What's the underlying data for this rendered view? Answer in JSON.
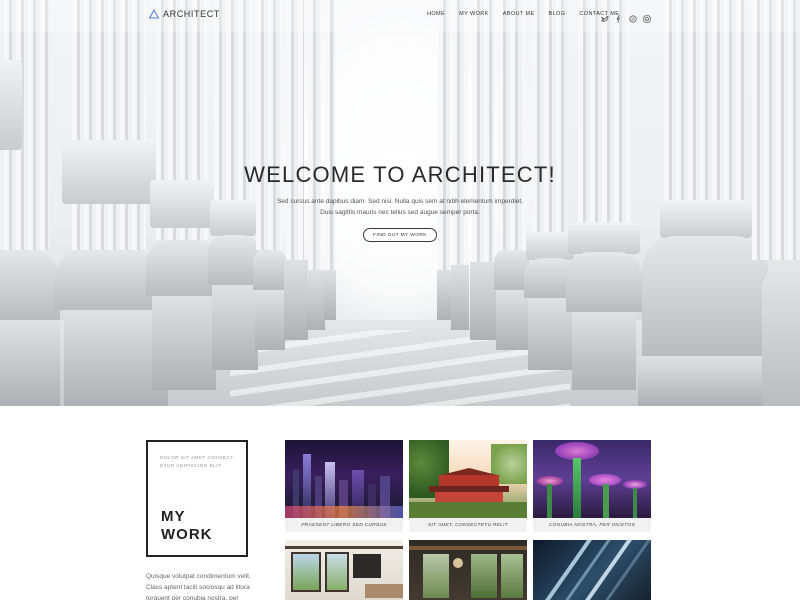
{
  "nav": {
    "logo_text": "ARCHITECT",
    "menu": [
      "HOME",
      "MY WORK",
      "ABOUT ME",
      "BLOG",
      "CONTACT ME"
    ],
    "social_icons": [
      "twitter-icon",
      "facebook-icon",
      "dribbble-icon",
      "instagram-icon"
    ]
  },
  "hero": {
    "title": "WELCOME TO ARCHITECT!",
    "subtitle_line1": "Sed cursus ante dapibus diam. Sed nisi. Nulla quis sem at nibh elementum imperdiet.",
    "subtitle_line2": "Duis sagittis mauris nec tellus sed augue semper porta.",
    "button_label": "FIND OUT MY WORK"
  },
  "work": {
    "kicker": "DOLOR SIT AMET CONSECT ETUR ADIPISCING ELIT.",
    "heading_line1": "MY",
    "heading_line2": "WORK",
    "paragraph": "Quisque volutpat condimentum velit. Class aptent taciti sociosqu ad litora torquent per conubia nostra, per",
    "tiles": [
      {
        "caption": "PRAESENT LIBERO SED CURSUS",
        "scene": "city-night"
      },
      {
        "caption": "SIT AMET, CONSECTETU RELIT",
        "scene": "pagoda"
      },
      {
        "caption": "CONUBIA NOSTRA, PER INCETOS",
        "scene": "supertrees"
      },
      {
        "caption": "",
        "scene": "living-room"
      },
      {
        "caption": "",
        "scene": "dark-interior"
      },
      {
        "caption": "",
        "scene": "glass-building"
      }
    ]
  },
  "colors": {
    "accent_blue": "#4a7fd4",
    "text_dark": "#2a2a2a",
    "caption_bg": "#f1f1f1"
  }
}
